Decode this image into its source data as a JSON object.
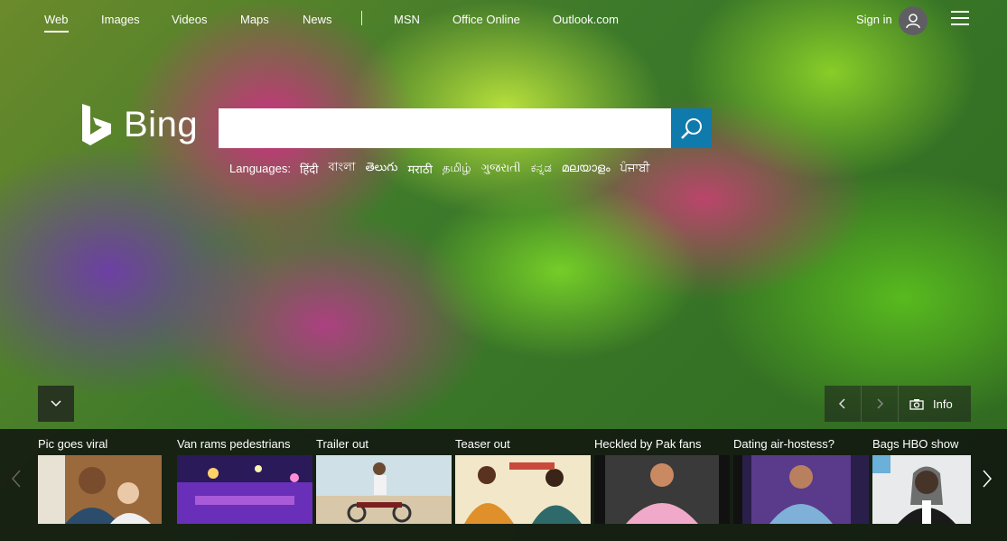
{
  "nav": {
    "items": [
      {
        "label": "Web",
        "active": true
      },
      {
        "label": "Images"
      },
      {
        "label": "Videos"
      },
      {
        "label": "Maps"
      },
      {
        "label": "News"
      },
      {
        "label": "MSN"
      },
      {
        "label": "Office Online"
      },
      {
        "label": "Outlook.com"
      }
    ],
    "signin_label": "Sign in"
  },
  "logo": {
    "text": "Bing"
  },
  "search": {
    "value": "",
    "placeholder": ""
  },
  "languages": {
    "label": "Languages:",
    "items": [
      "हिंदी",
      "বাংলা",
      "తెలుగు",
      "मराठी",
      "தமிழ்",
      "ગુજરાતી",
      "ಕನ್ನಡ",
      "മലയാളം",
      "ਪੰਜਾਬੀ"
    ]
  },
  "info": {
    "label": "Info"
  },
  "news": [
    {
      "title": "Pic goes viral"
    },
    {
      "title": "Van rams pedestrians"
    },
    {
      "title": "Trailer out"
    },
    {
      "title": "Teaser out"
    },
    {
      "title": "Heckled by Pak fans"
    },
    {
      "title": "Dating air-hostess?"
    },
    {
      "title": "Bags HBO show"
    }
  ],
  "colors": {
    "search_button": "#0f7bad",
    "strip_bg": "#0f0f0f"
  }
}
